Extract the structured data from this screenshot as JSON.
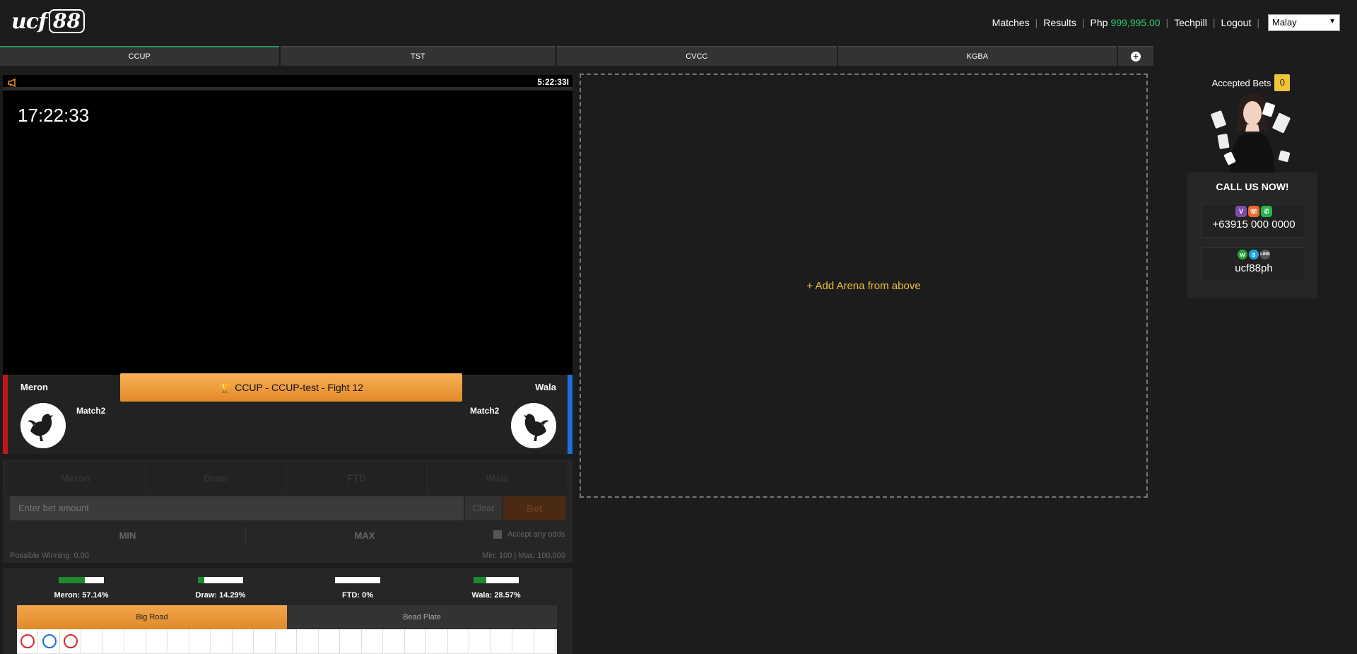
{
  "header": {
    "logo_text": "ucf",
    "logo_number": "88",
    "nav": {
      "matches": "Matches",
      "results": "Results",
      "currency": "Php",
      "balance": "999,995.00",
      "username": "Techpill",
      "logout": "Logout",
      "language": "Malay"
    },
    "colors": {
      "balance": "#2ecc71",
      "accent": "#1e9c5c"
    }
  },
  "tabs": [
    {
      "label": "CCUP",
      "active": true
    },
    {
      "label": "TST",
      "active": false
    },
    {
      "label": "CVCC",
      "active": false
    },
    {
      "label": "KGBA",
      "active": false
    }
  ],
  "video": {
    "topbar_time": "5:22:33I",
    "clock": "17:22:33"
  },
  "fight": {
    "banner": "CCUP - CCUP-test - Fight 12",
    "meron": {
      "side": "Meron",
      "name": "Match2",
      "color": "#c0151b"
    },
    "wala": {
      "side": "Wala",
      "name": "Match2",
      "color": "#1a6fd8"
    }
  },
  "bet": {
    "options": [
      "Meron",
      "Draw",
      "FTD",
      "Wala"
    ],
    "amount_placeholder": "Enter bet amount",
    "clear_label": "Clear",
    "bet_label": "Bet",
    "min_label": "MIN",
    "max_label": "MAX",
    "accept_odds_label": "Accept any odds",
    "possible_winning": "Possible Winning: 0.00",
    "limits": "Min: 100 | Max: 100,000"
  },
  "stats": [
    {
      "label": "Meron: 57.14%",
      "percent": 57.14
    },
    {
      "label": "Draw: 14.29%",
      "percent": 14.29
    },
    {
      "label": "FTD: 0%",
      "percent": 0
    },
    {
      "label": "Wala: 28.57%",
      "percent": 28.57
    }
  ],
  "road": {
    "tabs": [
      {
        "label": "Big Road",
        "active": true
      },
      {
        "label": "Bead Plate",
        "active": false
      }
    ],
    "results": [
      "meron",
      "wala",
      "meron"
    ],
    "colors": {
      "meron": "#d9262d",
      "wala": "#1a6fd8"
    }
  },
  "arena": {
    "add_text": "+ Add Arena from above"
  },
  "sidebar": {
    "accepted_label": "Accepted Bets",
    "accepted_count": "0",
    "call_us": "CALL US NOW!",
    "phone": "+63915 000 0000",
    "handle": "ucf88ph"
  }
}
